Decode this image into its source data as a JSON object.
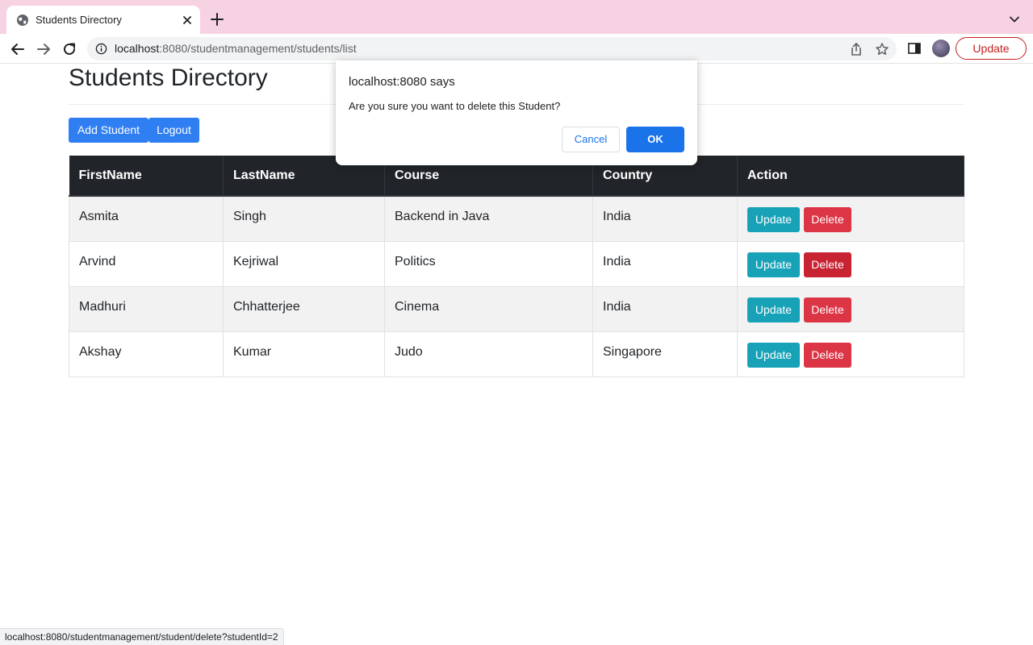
{
  "browser": {
    "tab_title": "Students Directory",
    "url_host": "localhost",
    "url_path": ":8080/studentmanagement/students/list",
    "update_label": "Update",
    "status_url": "localhost:8080/studentmanagement/student/delete?studentId=2"
  },
  "page": {
    "title": "Students Directory",
    "add_label": "Add Student",
    "logout_label": "Logout"
  },
  "table": {
    "headers": [
      "FirstName",
      "LastName",
      "Course",
      "Country",
      "Action"
    ],
    "rows": [
      {
        "first": "Asmita",
        "last": "Singh",
        "course": "Backend in Java",
        "country": "India",
        "update": "Update",
        "delete": "Delete"
      },
      {
        "first": "Arvind",
        "last": "Kejriwal",
        "course": "Politics",
        "country": "India",
        "update": "Update",
        "delete": "Delete"
      },
      {
        "first": "Madhuri",
        "last": "Chhatterjee",
        "course": "Cinema",
        "country": "India",
        "update": "Update",
        "delete": "Delete"
      },
      {
        "first": "Akshay",
        "last": "Kumar",
        "course": "Judo",
        "country": "Singapore",
        "update": "Update",
        "delete": "Delete"
      }
    ]
  },
  "dialog": {
    "title": "localhost:8080 says",
    "message": "Are you sure you want to delete this Student?",
    "cancel_label": "Cancel",
    "ok_label": "OK"
  },
  "colors": {
    "tabstrip": "#f6d2e3",
    "primary": "#2f7ff3",
    "info": "#17a2b8",
    "danger": "#dc3545",
    "table_header": "#212529"
  },
  "icons": {
    "tab_favicon": "globe-icon",
    "tab_close": "close-icon",
    "new_tab": "plus-icon",
    "tab_menu": "chevron-down-icon",
    "back": "back-arrow-icon",
    "forward": "forward-arrow-icon",
    "reload": "reload-icon",
    "site_info": "info-icon",
    "share": "share-icon",
    "bookmark": "star-icon",
    "side_panel": "side-panel-icon"
  }
}
